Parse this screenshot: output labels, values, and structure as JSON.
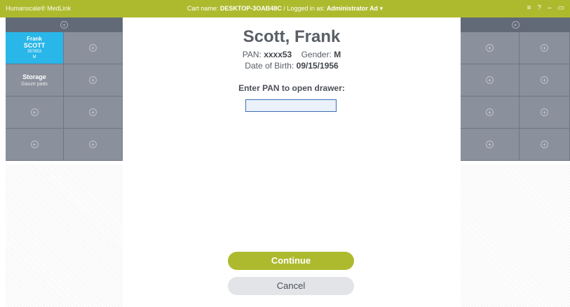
{
  "titlebar": {
    "brand": "Humanscale® MedLink",
    "cart_label": "Cart name:",
    "cart_name": "DESKTOP-3OAB48C",
    "separator": "/",
    "logged_label": "Logged in as:",
    "user": "Administrator Ad",
    "user_caret": "▾",
    "menu_icon": "≡",
    "help_icon": "?",
    "minimize_icon": "–",
    "restore_icon": "▭"
  },
  "plus_glyph": "+",
  "left_panel": {
    "patient": {
      "first": "Frank",
      "last": "SCOTT",
      "pan": "357853",
      "gender": "M"
    },
    "storage": {
      "title": "Storage",
      "subtitle": "Gauze pads"
    }
  },
  "main": {
    "patient_name": "Scott, Frank",
    "pan_label": "PAN:",
    "pan_value": "xxxx53",
    "gender_label": "Gender:",
    "gender_value": "M",
    "dob_label": "Date of Birth:",
    "dob_value": "09/15/1956",
    "prompt": "Enter PAN to open drawer:",
    "pan_input_value": "",
    "continue_label": "Continue",
    "cancel_label": "Cancel"
  },
  "colors": {
    "accent": "#aeba2e",
    "patient_tile": "#29b6e8",
    "tile": "#8a919c",
    "header": "#626a77"
  }
}
